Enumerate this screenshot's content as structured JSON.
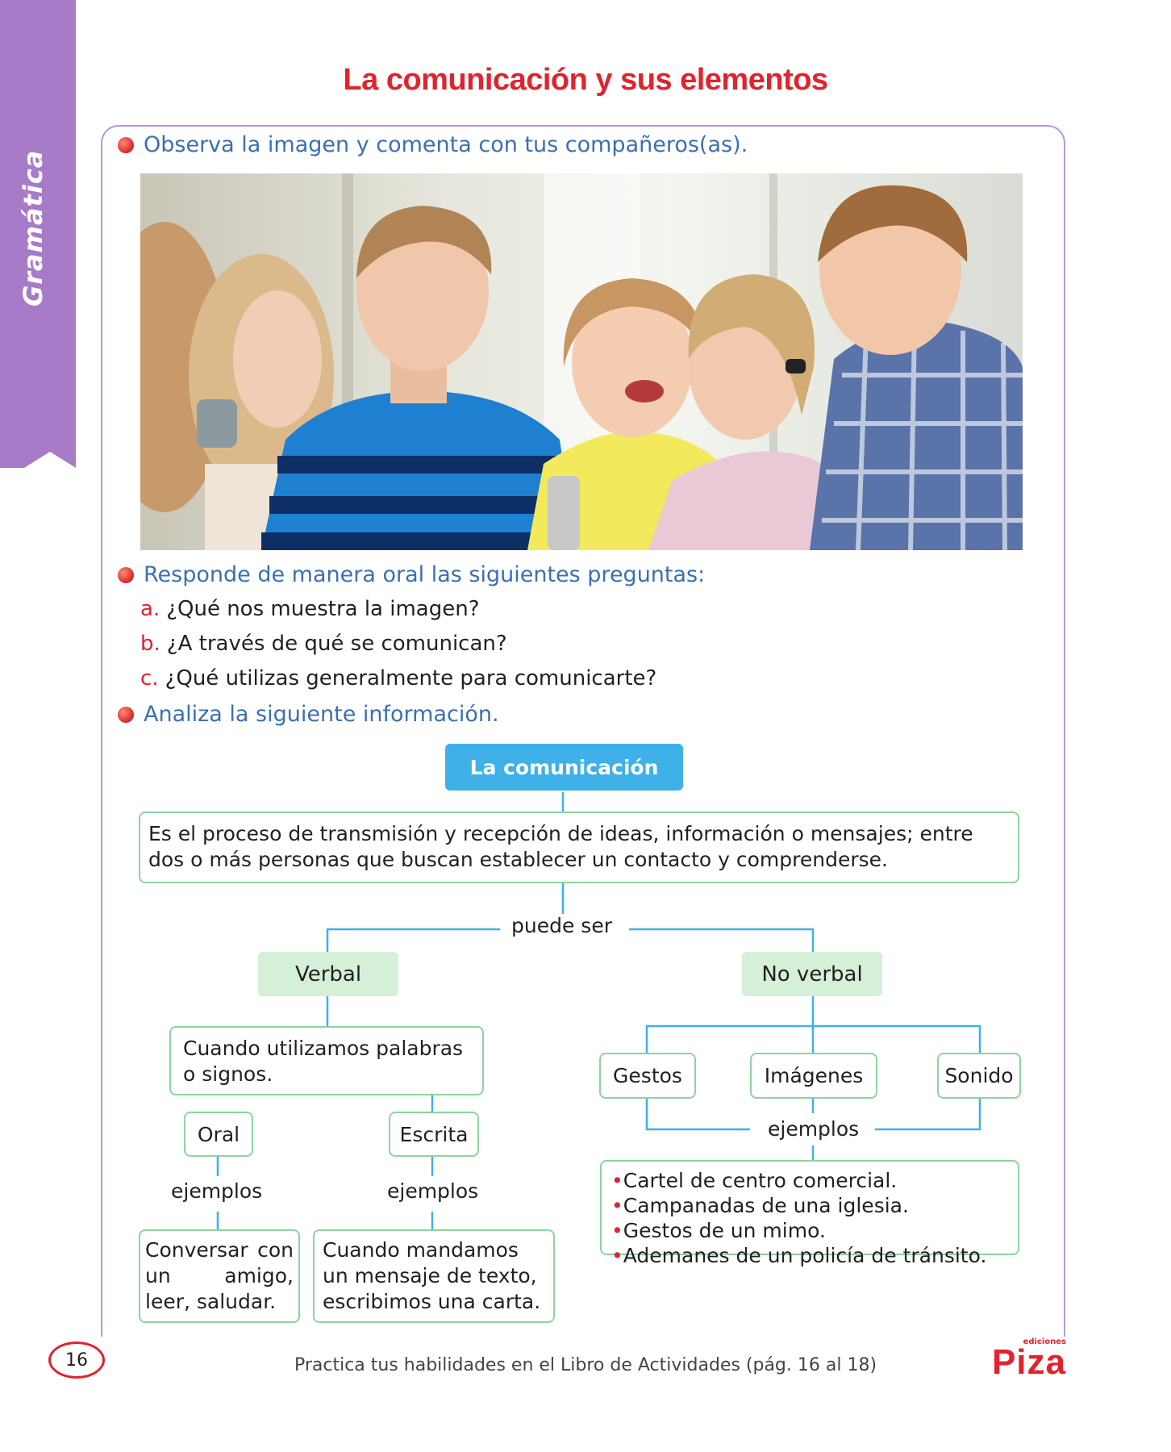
{
  "sidebar": {
    "label": "Gramática"
  },
  "title": "La comunicación y sus elementos",
  "instructions": {
    "observe": "Observa la imagen y comenta con tus compañeros(as).",
    "respond": "Responde de manera oral las siguientes preguntas:",
    "analyze": "Analiza la siguiente información."
  },
  "questions": [
    {
      "letter": "a.",
      "text": "¿Qué nos muestra la imagen?"
    },
    {
      "letter": "b.",
      "text": "¿A través de qué se comunican?"
    },
    {
      "letter": "c.",
      "text": "¿Qué utilizas generalmente para comunicarte?"
    }
  ],
  "map": {
    "root": "La comunicación",
    "definition": "Es el proceso de transmisión y recepción de ideas, información o mensajes; entre dos o más personas que buscan establecer un contacto y comprenderse.",
    "connector": "puede ser",
    "verbal": {
      "label": "Verbal",
      "description": "Cuando utilizamos palabras o signos.",
      "oral": {
        "label": "Oral",
        "connector": "ejemplos",
        "example": "Conversar con un amigo, leer, saludar."
      },
      "escrita": {
        "label": "Escrita",
        "connector": "ejemplos",
        "example": "Cuando mandamos un mensaje de texto, escribimos una carta."
      }
    },
    "noverbal": {
      "label": "No verbal",
      "types": [
        "Gestos",
        "Imágenes",
        "Sonido"
      ],
      "connector": "ejemplos",
      "examples": [
        "Cartel de centro comercial.",
        "Campanadas de una iglesia.",
        "Gestos de un mimo.",
        "Ademanes de un policía de tránsito."
      ]
    }
  },
  "footer": {
    "page_number": "16",
    "text": "Practica tus habilidades en el Libro de Actividades (pág. 16 al 18)",
    "logo_small": "ediciones",
    "logo": "Piza"
  },
  "colors": {
    "accent_red": "#e0232e",
    "blue_text": "#3b6fb3",
    "purple": "#a77bc8",
    "cyan": "#3fb0e8",
    "green": "#8ed3a0"
  }
}
